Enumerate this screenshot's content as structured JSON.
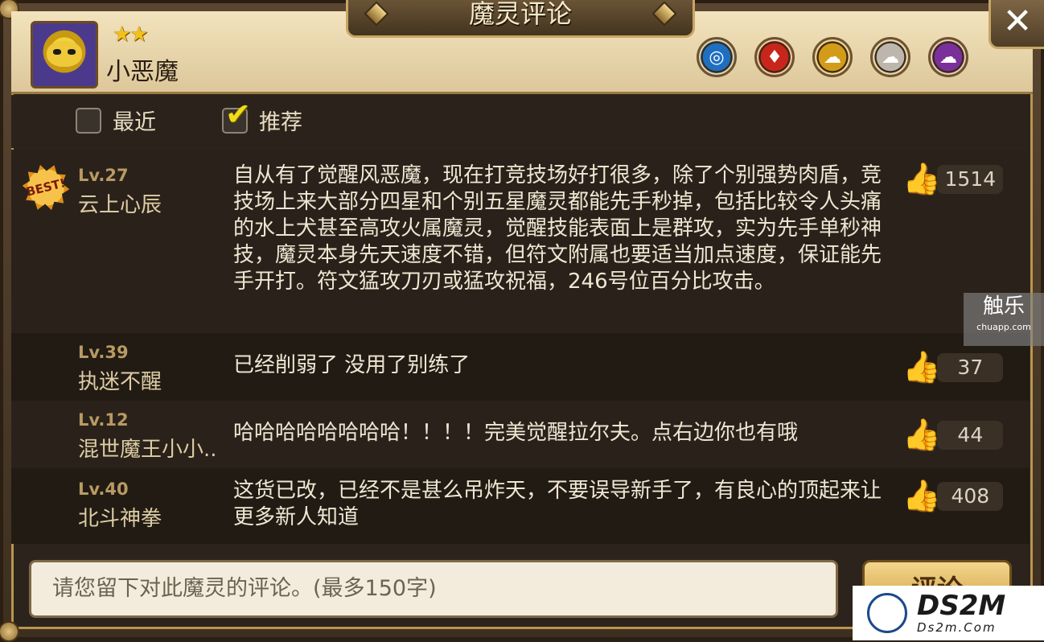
{
  "header": {
    "title": "魔灵评论",
    "close_label": "✕",
    "monster": {
      "stars": "★★",
      "name": "小恶魔"
    },
    "elements": [
      {
        "name": "water-icon",
        "glyph": "◎",
        "color": "#1f6fc0"
      },
      {
        "name": "fire-icon",
        "glyph": "♦",
        "color": "#c8261b"
      },
      {
        "name": "wind-icon",
        "glyph": "☁",
        "color": "#d29b18"
      },
      {
        "name": "light-icon",
        "glyph": "☁",
        "color": "#bdb6ac"
      },
      {
        "name": "dark-icon",
        "glyph": "☁",
        "color": "#7b2f9b"
      }
    ]
  },
  "filters": {
    "recent_label": "最近",
    "recommended_label": "推荐"
  },
  "comments": [
    {
      "best": true,
      "best_label": "BEST!",
      "level": "Lv.27",
      "user": "云上心辰",
      "text": "自从有了觉醒风恶魔，现在打竞技场好打很多，除了个别强势肉盾，竞技场上来大部分四星和个别五星魔灵都能先手秒掉，包括比较令人头痛的水上犬甚至高攻火属魔灵，觉醒技能表面上是群攻，实为先手单秒神技，魔灵本身先天速度不错，但符文附属也要适当加点速度，保证能先手开打。符文猛攻刀刃或猛攻祝福，246号位百分比攻击。",
      "likes": "1514"
    },
    {
      "best": false,
      "level": "Lv.39",
      "user": "执迷不醒",
      "text": "已经削弱了  没用了别练了",
      "likes": "37"
    },
    {
      "best": false,
      "level": "Lv.12",
      "user": "混世魔王小小..",
      "text": "哈哈哈哈哈哈哈哈！！！！完美觉醒拉尔夫。点右边你也有哦",
      "likes": "44"
    },
    {
      "best": false,
      "level": "Lv.40",
      "user": "北斗神拳",
      "text": "这货已改，已经不是甚么吊炸天，不要误导新手了，有良心的顶起来让更多新人知道",
      "likes": "408"
    }
  ],
  "input": {
    "placeholder": "请您留下对此魔灵的评论。(最多150字)"
  },
  "submit_label": "评论",
  "watermarks": {
    "chuapp_big": "触乐",
    "chuapp_small": "chuapp.com",
    "ds2m_big": "DS2M",
    "ds2m_small": "Ds2m.Com"
  }
}
